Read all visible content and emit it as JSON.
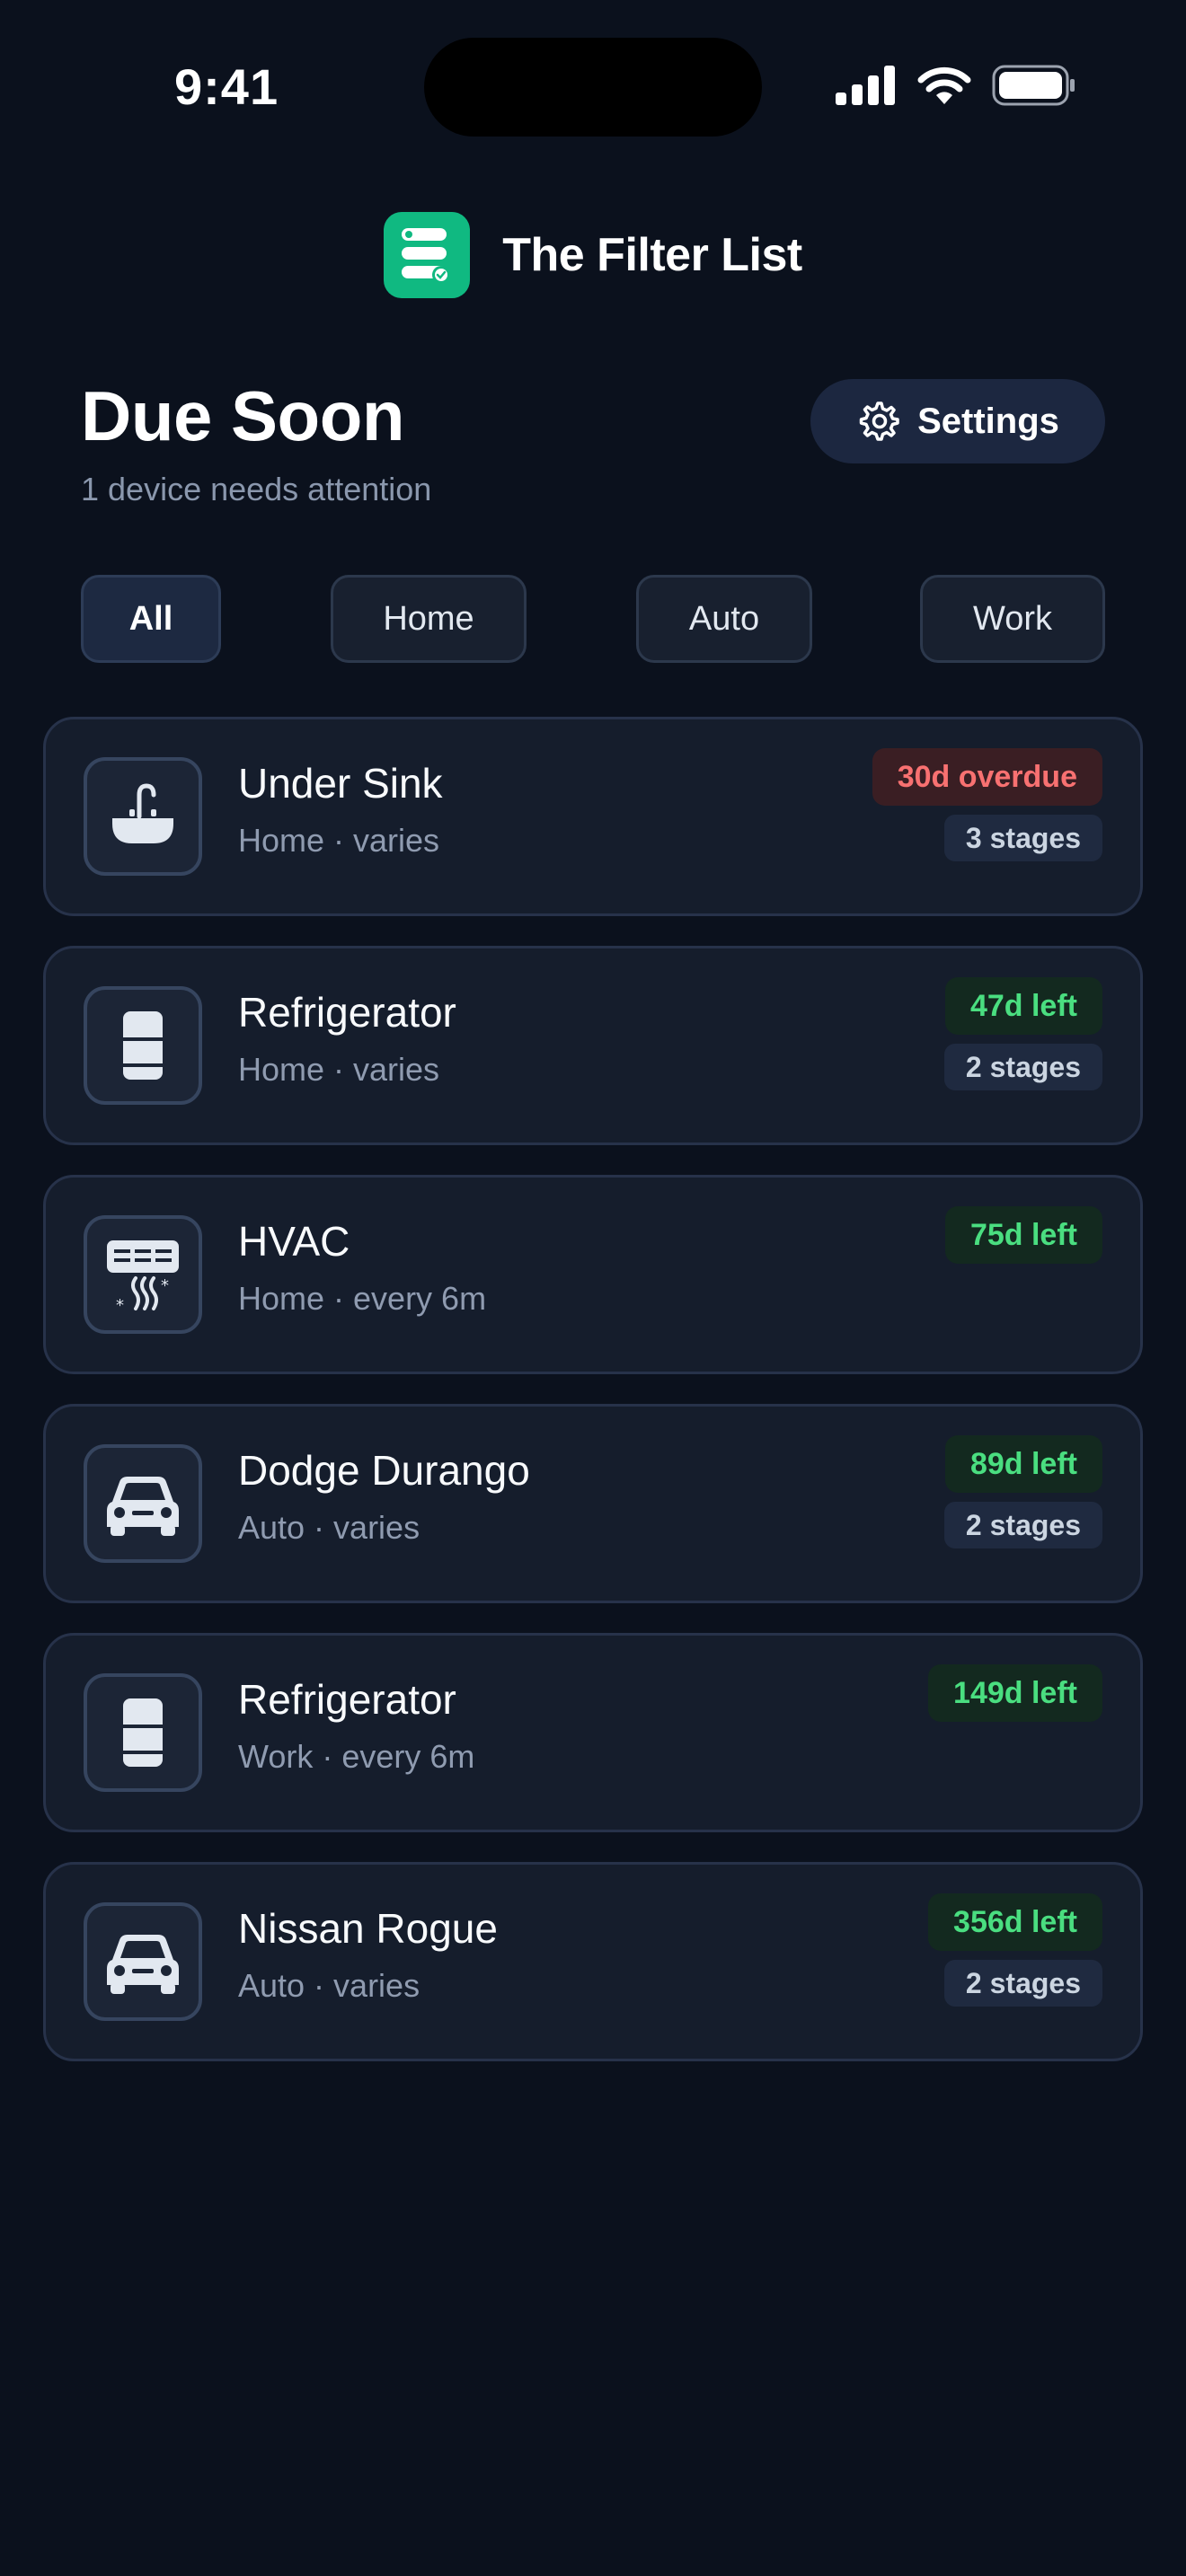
{
  "status_bar": {
    "time": "9:41"
  },
  "app": {
    "title": "The Filter List"
  },
  "header": {
    "title": "Due Soon",
    "subtitle": "1 device needs attention",
    "settings_label": "Settings"
  },
  "filters": [
    {
      "label": "All",
      "active": true
    },
    {
      "label": "Home",
      "active": false
    },
    {
      "label": "Auto",
      "active": false
    },
    {
      "label": "Work",
      "active": false
    }
  ],
  "devices": [
    {
      "name": "Under Sink",
      "meta": "Home · varies",
      "due": "30d overdue",
      "status": "overdue",
      "stages": "3 stages",
      "icon": "sink-icon"
    },
    {
      "name": "Refrigerator",
      "meta": "Home · varies",
      "due": "47d left",
      "status": "ok",
      "stages": "2 stages",
      "icon": "refrigerator-icon"
    },
    {
      "name": "HVAC",
      "meta": "Home · every 6m",
      "due": "75d left",
      "status": "ok",
      "stages": "",
      "icon": "air-conditioner-icon"
    },
    {
      "name": "Dodge Durango",
      "meta": "Auto · varies",
      "due": "89d left",
      "status": "ok",
      "stages": "2 stages",
      "icon": "car-icon"
    },
    {
      "name": "Refrigerator",
      "meta": "Work · every 6m",
      "due": "149d left",
      "status": "ok",
      "stages": "",
      "icon": "refrigerator-icon"
    },
    {
      "name": "Nissan Rogue",
      "meta": "Auto · varies",
      "due": "356d left",
      "status": "ok",
      "stages": "2 stages",
      "icon": "car-icon"
    }
  ],
  "colors": {
    "background": "#0b111d",
    "brand": "#10b981",
    "overdue": "#f87171",
    "ok": "#4ade80"
  }
}
